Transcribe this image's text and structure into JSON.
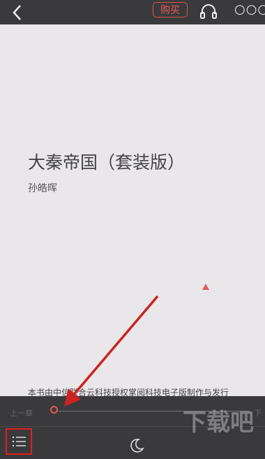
{
  "topbar": {
    "buy_label": "购买"
  },
  "book": {
    "title": "大秦帝国（套装版）",
    "author": "孙皓晖",
    "publisher_note": "本书由中信联合云科技授权掌阅科技电子版制作与发行"
  },
  "bottombar": {
    "prev_label": "上一章",
    "next_label": "下",
    "progress_fraction": 0.0
  },
  "watermark": {
    "text": "下载吧"
  },
  "colors": {
    "accent": "#e25b55",
    "highlight_box": "#e02020",
    "bar_bg": "#3a3a3c",
    "page_bg": "#e9e7ea"
  },
  "icons": [
    "back-icon",
    "headphones-icon",
    "more-icon",
    "toc-icon",
    "moon-icon"
  ]
}
